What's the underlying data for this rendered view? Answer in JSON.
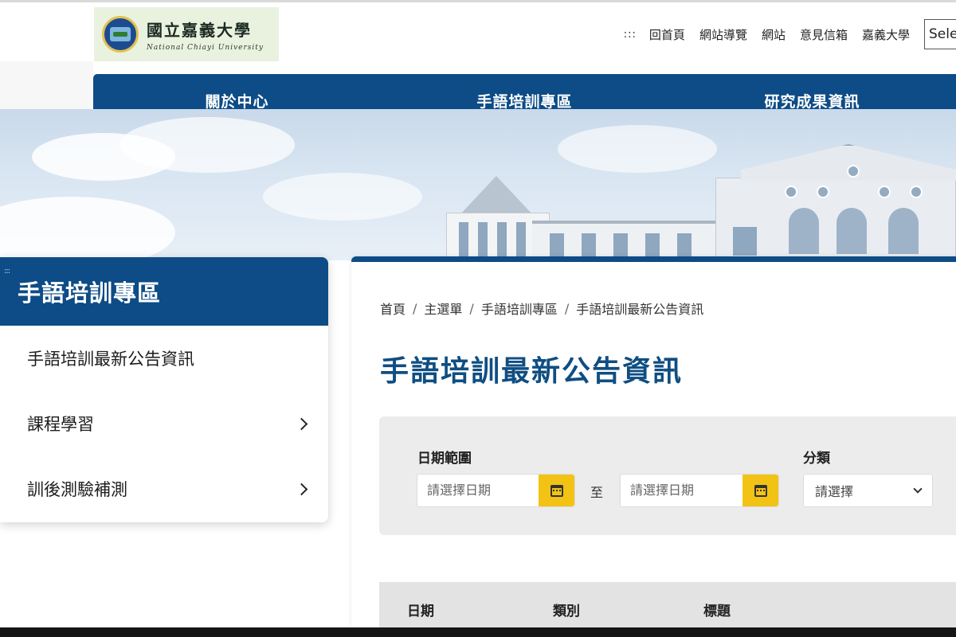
{
  "header": {
    "logo_zh": "國立嘉義大學",
    "logo_en": "National Chiayi University",
    "utility_links": [
      {
        "label": ":::"
      },
      {
        "label": "回首頁"
      },
      {
        "label": "網站導覽"
      },
      {
        "label": "網站"
      },
      {
        "label": "意見信箱"
      },
      {
        "label": "嘉義大學"
      }
    ],
    "language_select": "Sele"
  },
  "main_nav": {
    "items": [
      {
        "label": "關於中心"
      },
      {
        "label": "手語培訓專區"
      },
      {
        "label": "研究成果資訊"
      }
    ]
  },
  "sidebar": {
    "handle": ":::",
    "title": "手語培訓專區",
    "items": [
      {
        "label": "手語培訓最新公告資訊",
        "has_submenu": false
      },
      {
        "label": "課程學習",
        "has_submenu": true
      },
      {
        "label": "訓後測驗補測",
        "has_submenu": true
      }
    ]
  },
  "content": {
    "breadcrumb": [
      "首頁",
      "主選單",
      "手語培訓專區",
      "手語培訓最新公告資訊"
    ],
    "breadcrumb_separator": "/",
    "page_title": "手語培訓最新公告資訊",
    "filter": {
      "date_range_label": "日期範圍",
      "start_placeholder": "請選擇日期",
      "to_text": "至",
      "end_placeholder": "請選擇日期",
      "category_label": "分類",
      "category_value": "請選擇"
    },
    "table": {
      "columns": [
        "日期",
        "類別",
        "標題"
      ]
    }
  },
  "colors": {
    "primary": "#0d4c86",
    "accent_yellow": "#f2c314",
    "title_blue": "#0f4e82"
  }
}
